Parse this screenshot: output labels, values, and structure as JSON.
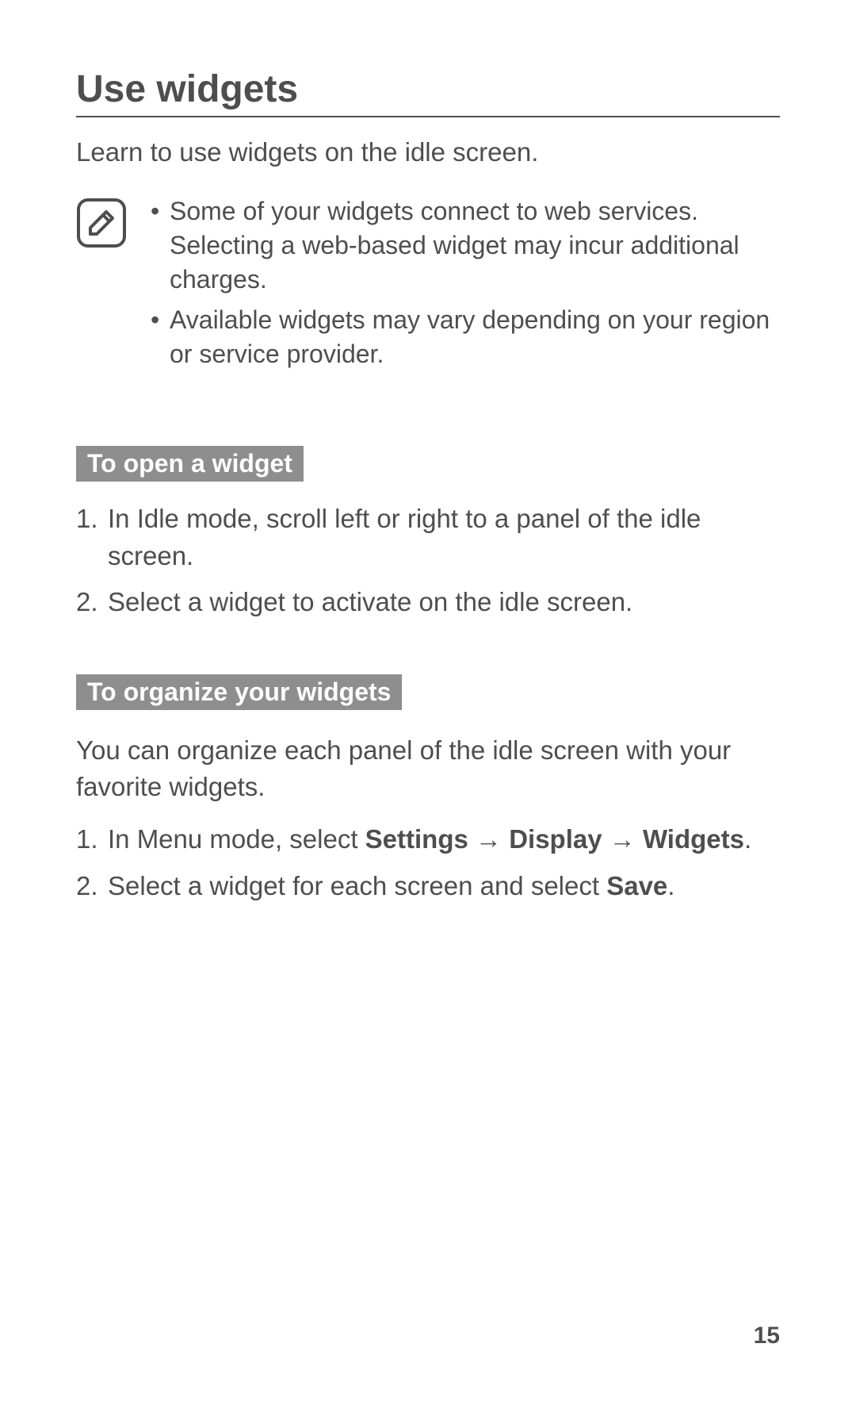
{
  "heading": "Use widgets",
  "intro": "Learn to use widgets on the idle screen.",
  "note_icon": "note-pencil-icon",
  "notes": [
    "Some of your widgets connect to web services. Selecting a web-based widget may incur additional charges.",
    "Available widgets may vary depending on your region or service provider."
  ],
  "section1": {
    "title": "To open a widget",
    "steps": [
      "In Idle mode, scroll left or right to a panel of the idle screen.",
      "Select a widget to activate on the idle screen."
    ]
  },
  "section2": {
    "title": "To organize your widgets",
    "intro": "You can organize each panel of the idle screen with your favorite widgets.",
    "step1_pre": "In Menu mode, select ",
    "step1_b1": "Settings",
    "step1_arrow1": " → ",
    "step1_b2": "Display",
    "step1_arrow2": " → ",
    "step1_b3": "Widgets",
    "step1_post": ".",
    "step2_pre": "Select a widget for each screen and select ",
    "step2_b1": "Save",
    "step2_post": "."
  },
  "page_number": "15"
}
